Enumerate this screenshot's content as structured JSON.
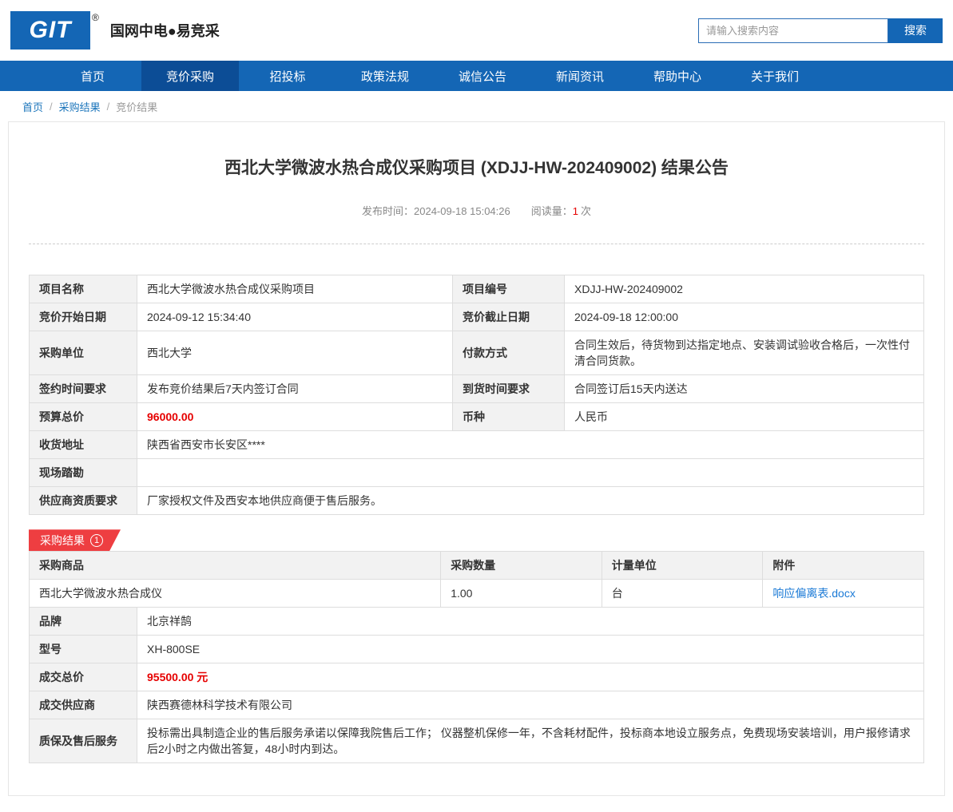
{
  "colors": {
    "brand_blue": "#1466b5",
    "nav_active_blue": "#0c4d96",
    "price_red": "#e60000",
    "badge_red": "#ee3e41",
    "link_blue": "#1b7ad6"
  },
  "header": {
    "logo": {
      "text": "GIT",
      "registered": "®"
    },
    "site_title": "国网中电●易竞采",
    "search": {
      "placeholder": "请输入搜索内容",
      "button": "搜索"
    }
  },
  "nav": {
    "items": [
      {
        "label": "首页"
      },
      {
        "label": "竞价采购"
      },
      {
        "label": "招投标"
      },
      {
        "label": "政策法规"
      },
      {
        "label": "诚信公告"
      },
      {
        "label": "新闻资讯"
      },
      {
        "label": "帮助中心"
      },
      {
        "label": "关于我们"
      }
    ],
    "active_index": 1
  },
  "breadcrumb": {
    "home": "首页",
    "sep": "/",
    "section": "采购结果",
    "current": "竞价结果"
  },
  "article": {
    "title": "西北大学微波水热合成仪采购项目 (XDJJ-HW-202409002) 结果公告",
    "publish_label": "发布时间：",
    "publish_value": "2024-09-18 15:04:26",
    "views_label": "阅读量：",
    "views_value": "1",
    "views_suffix": "次"
  },
  "info_table": {
    "rows": [
      {
        "l1": "项目名称",
        "v1": "西北大学微波水热合成仪采购项目",
        "l2": "项目编号",
        "v2": "XDJJ-HW-202409002"
      },
      {
        "l1": "竞价开始日期",
        "v1": "2024-09-12 15:34:40",
        "l2": "竞价截止日期",
        "v2": "2024-09-18 12:00:00"
      },
      {
        "l1": "采购单位",
        "v1": "西北大学",
        "l2": "付款方式",
        "v2": "合同生效后，待货物到达指定地点、安装调试验收合格后，一次性付清合同货款。"
      },
      {
        "l1": "签约时间要求",
        "v1": "发布竞价结果后7天内签订合同",
        "l2": "到货时间要求",
        "v2": "合同签订后15天内送达"
      },
      {
        "l1": "预算总价",
        "v1": "96000.00",
        "l2": "币种",
        "v2": "人民币"
      }
    ],
    "full_rows": [
      {
        "label": "收货地址",
        "value": "陕西省西安市长安区****"
      },
      {
        "label": "现场踏勘",
        "value": ""
      },
      {
        "label": "供应商资质要求",
        "value": "厂家授权文件及西安本地供应商便于售后服务。"
      }
    ]
  },
  "result": {
    "badge_label": "采购结果",
    "badge_count": "1",
    "headers": [
      "采购商品",
      "采购数量",
      "计量单位",
      "附件"
    ],
    "item": {
      "product": "西北大学微波水热合成仪",
      "quantity": "1.00",
      "unit": "台",
      "attachment": "响应偏离表.docx"
    },
    "details": [
      {
        "label": "品牌",
        "value": "北京祥鹄"
      },
      {
        "label": "型号",
        "value": "XH-800SE"
      },
      {
        "label": "成交总价",
        "value": "95500.00 元"
      },
      {
        "label": "成交供应商",
        "value": "陕西赛德林科学技术有限公司"
      },
      {
        "label": "质保及售后服务",
        "value": "投标需出具制造企业的售后服务承诺以保障我院售后工作； 仪器整机保修一年，不含耗材配件，投标商本地设立服务点，免费现场安装培训，用户报修请求后2小时之内做出答复，48小时内到达。"
      }
    ]
  }
}
